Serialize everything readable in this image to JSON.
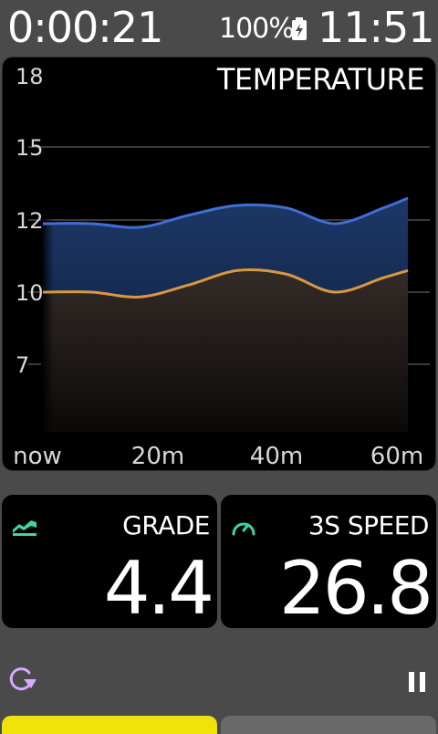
{
  "status": {
    "elapsed_time": "0:00:21",
    "battery_percent": "100%",
    "battery_icon": "battery-charging-icon",
    "clock": "11:51"
  },
  "chart_title": "TEMPERATURE",
  "chart_data": {
    "type": "area",
    "title": "TEMPERATURE",
    "x_labels": [
      "now",
      "20m",
      "40m",
      "60m"
    ],
    "y_ticks": [
      18,
      15,
      12,
      10,
      7
    ],
    "grid": true,
    "series": [
      {
        "color": "#3f6fd6",
        "x": [
          0,
          8,
          16,
          24,
          32,
          40,
          48,
          56,
          60
        ],
        "values": [
          11.9,
          11.9,
          11.8,
          12.2,
          12.6,
          12.5,
          11.9,
          12.5,
          12.9
        ]
      },
      {
        "color": "#d99840",
        "x": [
          0,
          8,
          16,
          24,
          32,
          40,
          48,
          56,
          60
        ],
        "values": [
          10.0,
          10.0,
          9.8,
          10.2,
          10.6,
          10.5,
          10.0,
          10.4,
          10.6
        ]
      }
    ]
  },
  "tiles": {
    "grade": {
      "label": "GRADE",
      "value": "4.4",
      "icon": "grade-icon"
    },
    "speed": {
      "label": "3S SPEED",
      "value": "26.8",
      "icon": "speedometer-icon"
    }
  },
  "controls": {
    "left_icon": "refresh-icon",
    "right_icon": "pause-icon"
  },
  "colors": {
    "accent_green": "#3cd6a4",
    "accent_purple": "#d9a8ff",
    "active_page_tab": "#f2e20b"
  }
}
